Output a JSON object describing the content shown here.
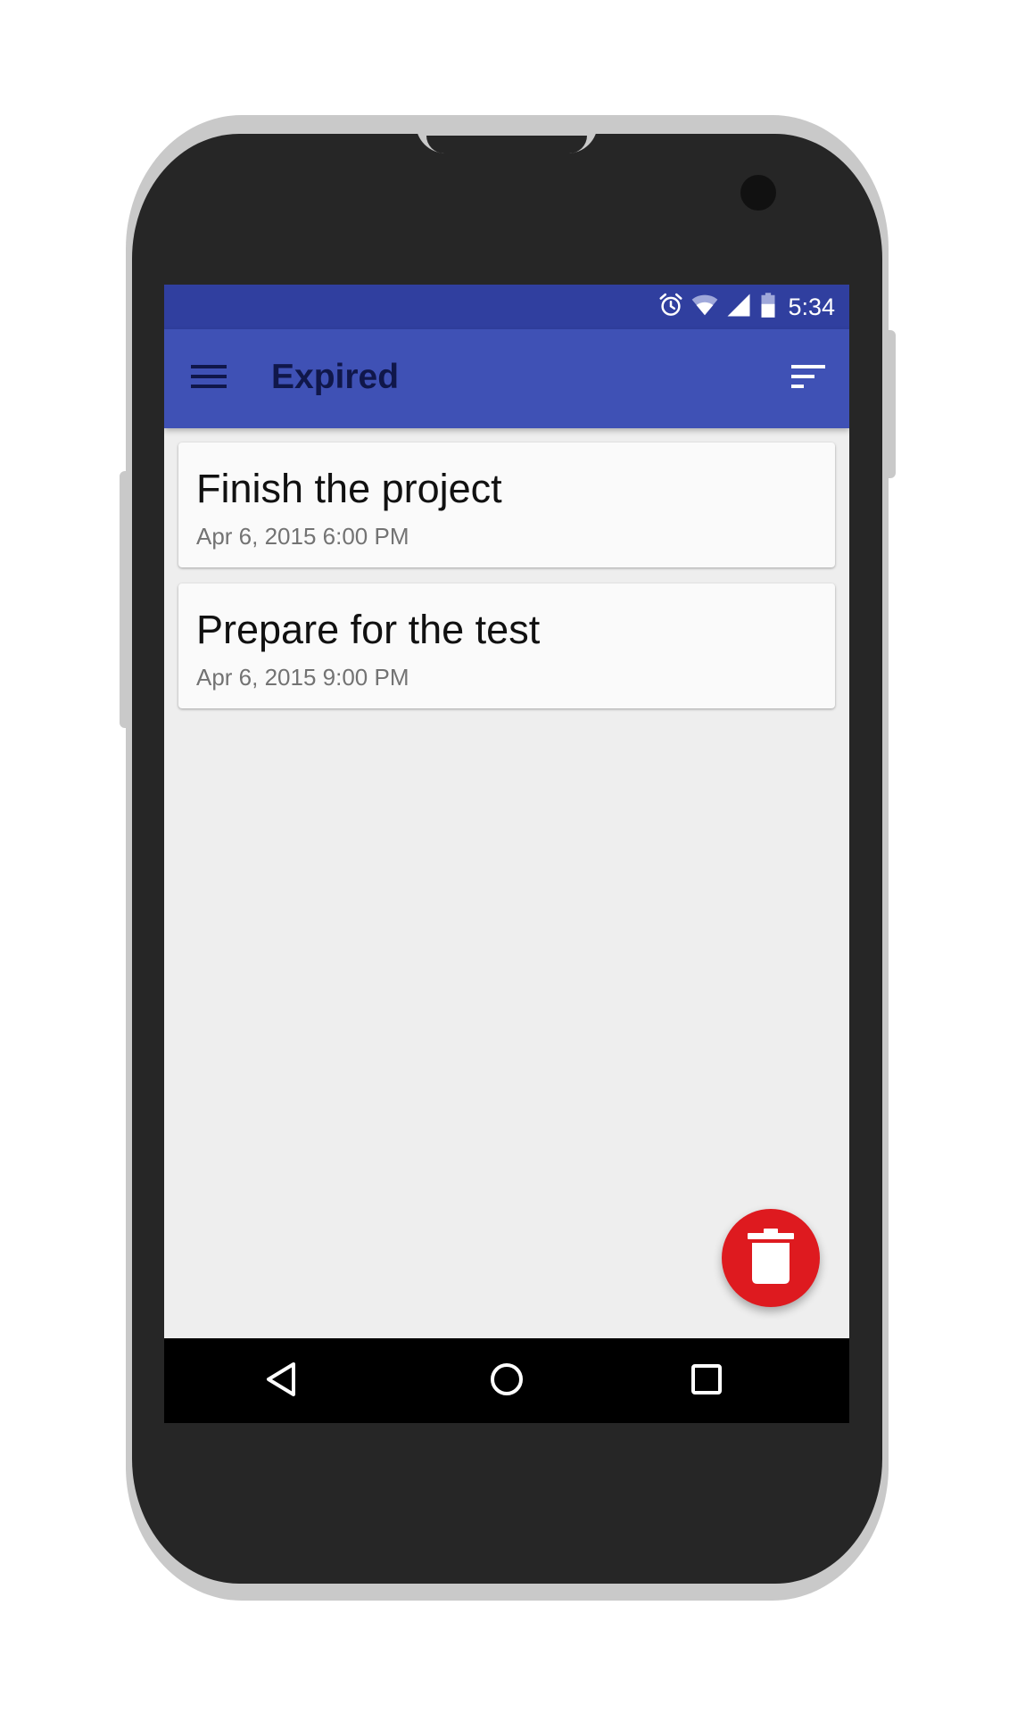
{
  "status_bar": {
    "time": "5:34",
    "icons": [
      "alarm-icon",
      "wifi-icon",
      "cell-signal-icon",
      "battery-icon"
    ],
    "color": "#303f9f"
  },
  "app_bar": {
    "title": "Expired",
    "menu_icon": "hamburger-menu-icon",
    "sort_icon": "sort-icon",
    "color": "#3f51b5"
  },
  "tasks": [
    {
      "title": "Finish the project",
      "date": "Apr 6, 2015 6:00 PM"
    },
    {
      "title": "Prepare for the test",
      "date": "Apr 6, 2015 9:00 PM"
    }
  ],
  "fab": {
    "icon": "trash-icon",
    "color": "#de1a1f"
  },
  "nav_bar": {
    "icons": [
      "back-icon",
      "home-icon",
      "recents-icon"
    ]
  }
}
